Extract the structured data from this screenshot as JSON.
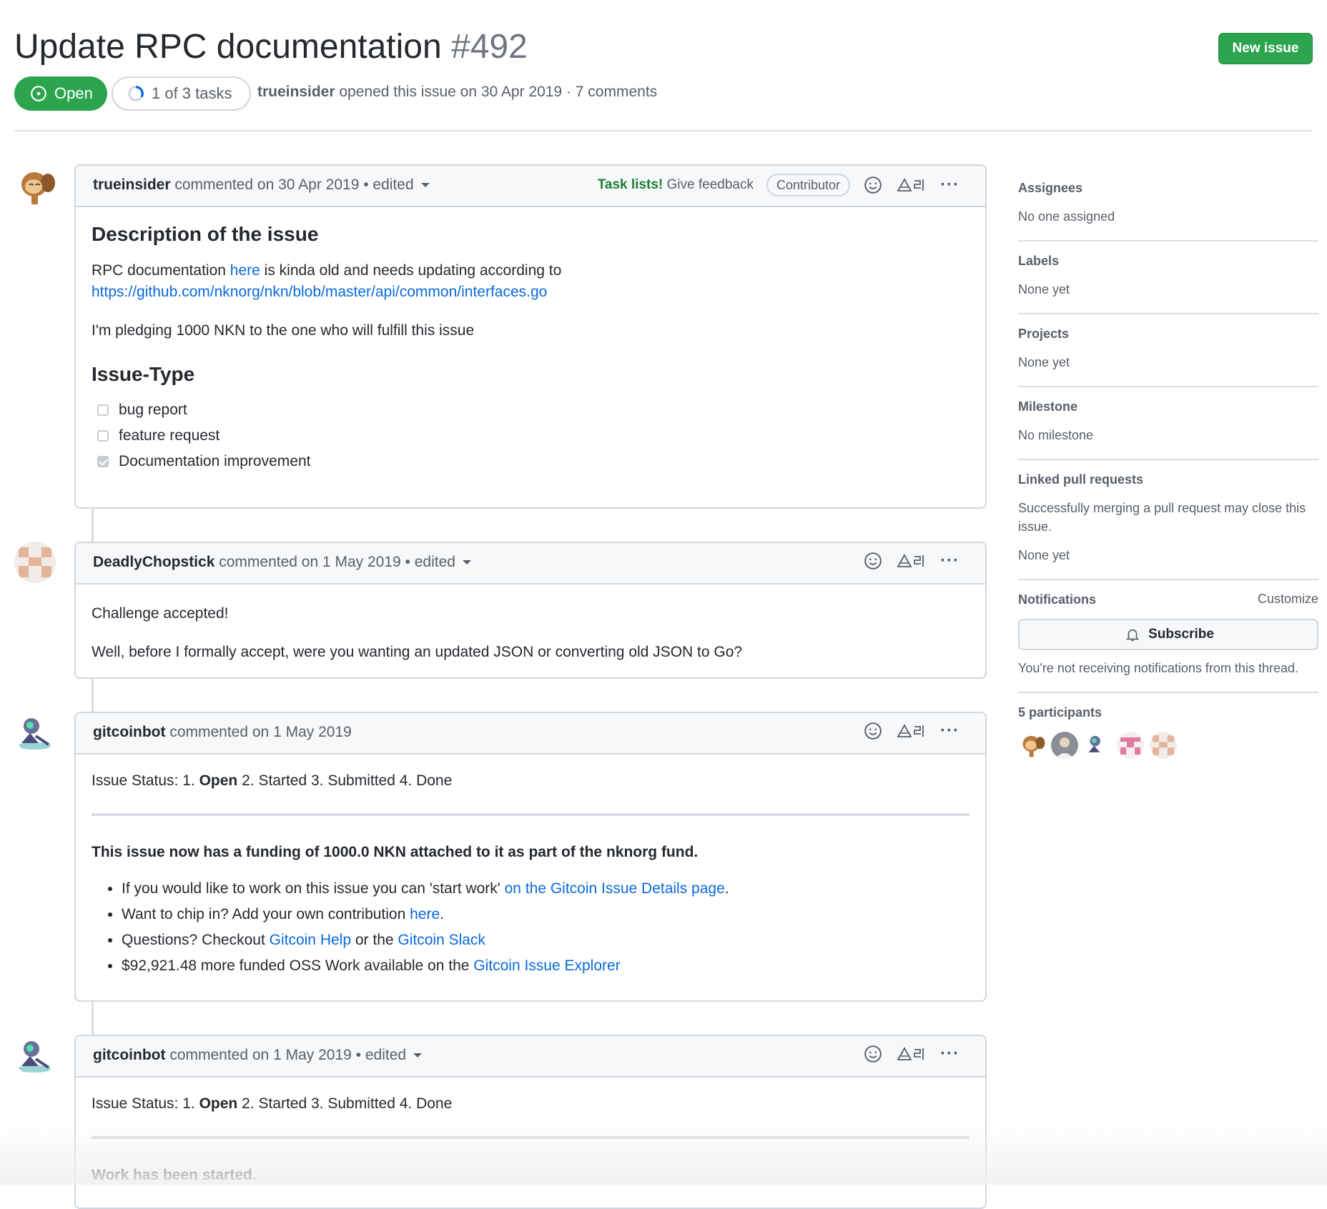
{
  "issue": {
    "title": "Update RPC documentation",
    "number": "#492",
    "state": "Open",
    "tasks": "1 of 3 tasks",
    "author": "trueinsider",
    "opened_text": "opened this issue on 30 Apr 2019 · 7 comments"
  },
  "header": {
    "new_issue_label": "New issue"
  },
  "comments": [
    {
      "author": "trueinsider",
      "meta": "commented on 30 Apr 2019 • edited",
      "tasklists_label": "Task lists!",
      "feedback_label": "Give feedback",
      "role": "Contributor",
      "heading1": "Description of the issue",
      "p1_before": "RPC documentation ",
      "p1_link": "here",
      "p1_after": " is kinda old and needs updating according to",
      "p1_url": "https://github.com/nknorg/nkn/blob/master/api/common/interfaces.go",
      "p2": "I'm pledging 1000 NKN to the one who will fulfill this issue",
      "heading2": "Issue-Type",
      "checklist": [
        {
          "label": "bug report",
          "checked": false
        },
        {
          "label": "feature request",
          "checked": false
        },
        {
          "label": "Documentation improvement",
          "checked": true
        }
      ]
    },
    {
      "author": "DeadlyChopstick",
      "meta": "commented on 1 May 2019 • edited",
      "p1": "Challenge accepted!",
      "p2": "Well, before I formally accept, were you wanting an updated JSON or converting old JSON to Go?"
    },
    {
      "author": "gitcoinbot",
      "meta": "commented on 1 May 2019",
      "status_prefix": "Issue Status: 1. ",
      "status_bold": "Open",
      "status_rest": " 2. Started 3. Submitted 4. Done",
      "funding": "This issue now has a funding of 1000.0 NKN attached to it as part of the nknorg fund.",
      "b1_text": "If you would like to work on this issue you can 'start work' ",
      "b1_link": "on the Gitcoin Issue Details page",
      "b1_end": ".",
      "b2_text": "Want to chip in? Add your own contribution ",
      "b2_link": "here",
      "b2_end": ".",
      "b3_text": "Questions? Checkout ",
      "b3_link1": "Gitcoin Help",
      "b3_mid": " or the ",
      "b3_link2": "Gitcoin Slack",
      "b4_text": "$92,921.48 more funded OSS Work available on the ",
      "b4_link": "Gitcoin Issue Explorer"
    },
    {
      "author": "gitcoinbot",
      "meta": "commented on 1 May 2019 • edited",
      "status_prefix": "Issue Status: 1. ",
      "status_bold": "Open",
      "status_rest": " 2. Started 3. Submitted 4. Done",
      "started": "Work has been started."
    }
  ],
  "sidebar": {
    "assignees": {
      "title": "Assignees",
      "value": "No one assigned"
    },
    "labels": {
      "title": "Labels",
      "value": "None yet"
    },
    "projects": {
      "title": "Projects",
      "value": "None yet"
    },
    "milestone": {
      "title": "Milestone",
      "value": "No milestone"
    },
    "linked_prs": {
      "title": "Linked pull requests",
      "desc": "Successfully merging a pull request may close this issue.",
      "value": "None yet"
    },
    "notifications": {
      "title": "Notifications",
      "customize": "Customize",
      "subscribe": "Subscribe",
      "note": "You're not receiving notifications from this thread."
    },
    "participants": {
      "title": "5 participants"
    }
  },
  "colors": {
    "accent_green": "#2da44e",
    "link_blue": "#0969da",
    "border": "#d0d7de"
  },
  "icons": [
    "issue-opened-icon",
    "task-progress-icon",
    "smiley-icon",
    "translate-icon",
    "kebab-icon",
    "bell-icon",
    "caret-down-icon"
  ]
}
